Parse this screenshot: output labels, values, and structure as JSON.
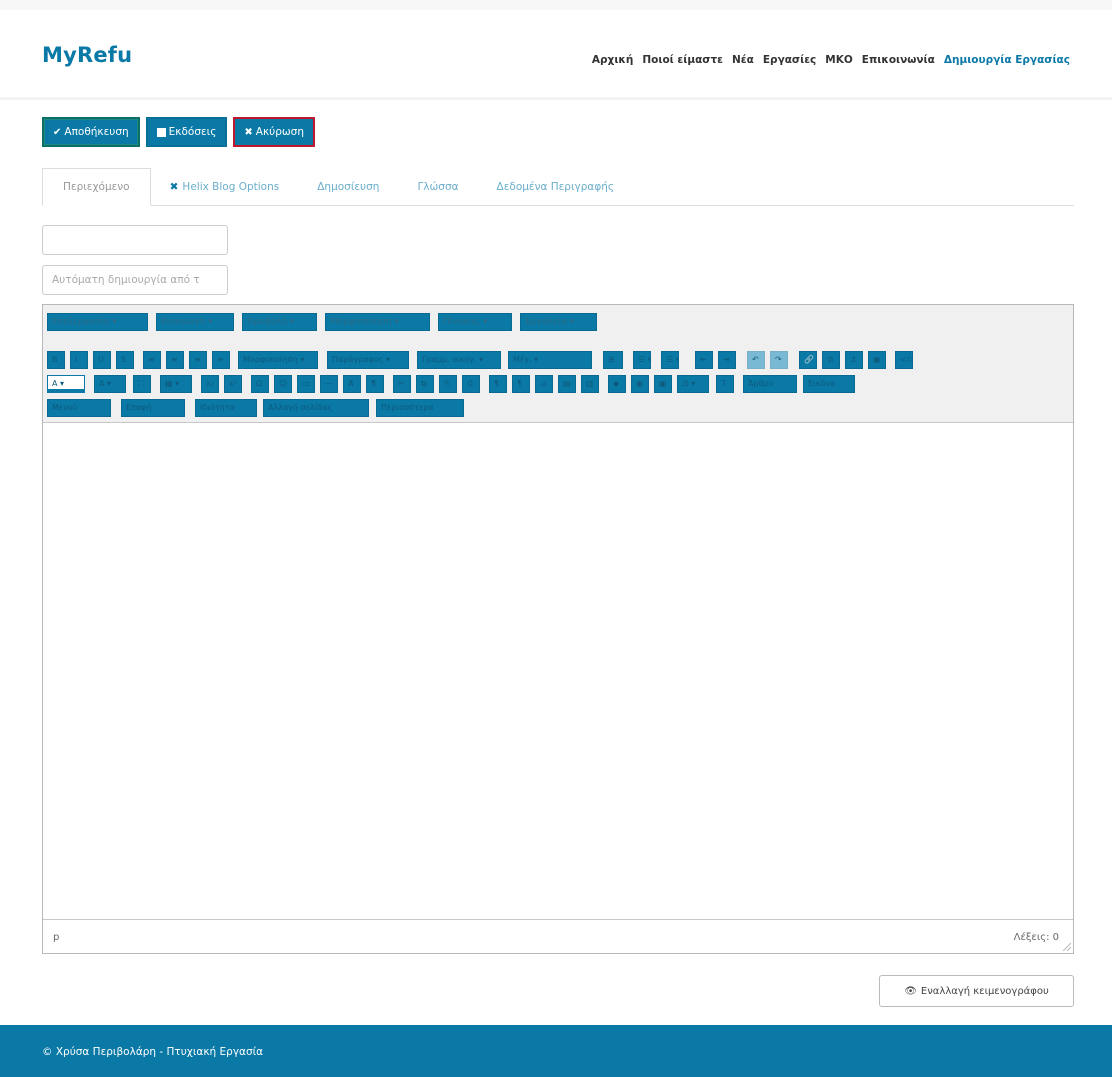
{
  "site": {
    "logo": "MyRefu"
  },
  "nav": {
    "items": [
      "Αρχική",
      "Ποιοί είμαστε",
      "Νέα",
      "Εργασίες",
      "ΜΚΟ",
      "Επικοινωνία"
    ],
    "active": "Δημιουργία Εργασίας"
  },
  "toolbar": {
    "save_icon": "✔",
    "save_label": "Αποθήκευση",
    "versions_label": "Εκδόσεις",
    "cancel_icon": "✖",
    "cancel_label": "Ακύρωση"
  },
  "tabs": {
    "content": "Περιεχόμενο",
    "helix_icon": "✖",
    "helix": "Helix Blog Options",
    "publish": "Δημοσίευση",
    "language": "Γλώσσα",
    "metadata": "Δεδομένα Περιγραφής"
  },
  "form": {
    "title_value": "",
    "alias_placeholder": "Αυτόματη δημιουργία από τ"
  },
  "editor": {
    "menus": [
      "Επεξεργασία ▾",
      "Εισαγωγή ▾",
      "Προβολή ▾",
      "Μορφοποίηση ▾",
      "Πίνακας ▾",
      "Εργαλεία ▾"
    ],
    "toolbar_row1": [
      "B",
      "I",
      "U",
      "S",
      "≡",
      "≡",
      "≡",
      "≡",
      "Μορφοποίηση ▾",
      "Παράγραφος ▾",
      "Γραμμ. οικογ. ▾",
      "Μέγ. ▾",
      "⊞",
      "☰ ▾",
      "☰ ▾",
      "⇤",
      "⇥",
      "↶",
      "↷",
      "🔗",
      "⊘",
      "⚓",
      "▣",
      "</>"
    ],
    "toolbar_row2": [
      "A ▾",
      "A ▾",
      "⛶",
      "▦ ▾",
      "x₂",
      "x²",
      "Ω",
      "☺",
      "▭",
      "—",
      "Ⱥ",
      "¶",
      "✂",
      "⧉",
      "⎘",
      "⎙",
      "¶",
      "¶",
      "⊿",
      "▤",
      "▥",
      "◆",
      "◉",
      "▣",
      "⊡ ▾",
      "Ꞁ",
      "Άρθρο",
      "Εικόνα"
    ],
    "toolbar_row3": [
      "Μενού",
      "Επαφή",
      "Ιδιότητα",
      "Αλλαγή σελίδας",
      "Περισσότερα"
    ],
    "status_path": "p",
    "word_count": "Λέξεις: 0"
  },
  "toggle_editor": {
    "icon": "👁",
    "label": "Εναλλαγή κειμενογράφου"
  },
  "footer": {
    "text": "© Χρύσα Περιβολάρη - Πτυχιακή Εργασία"
  },
  "colors": {
    "primary": "#0a79a6",
    "cancel_border": "#c0182b",
    "background": "#ffffff"
  }
}
